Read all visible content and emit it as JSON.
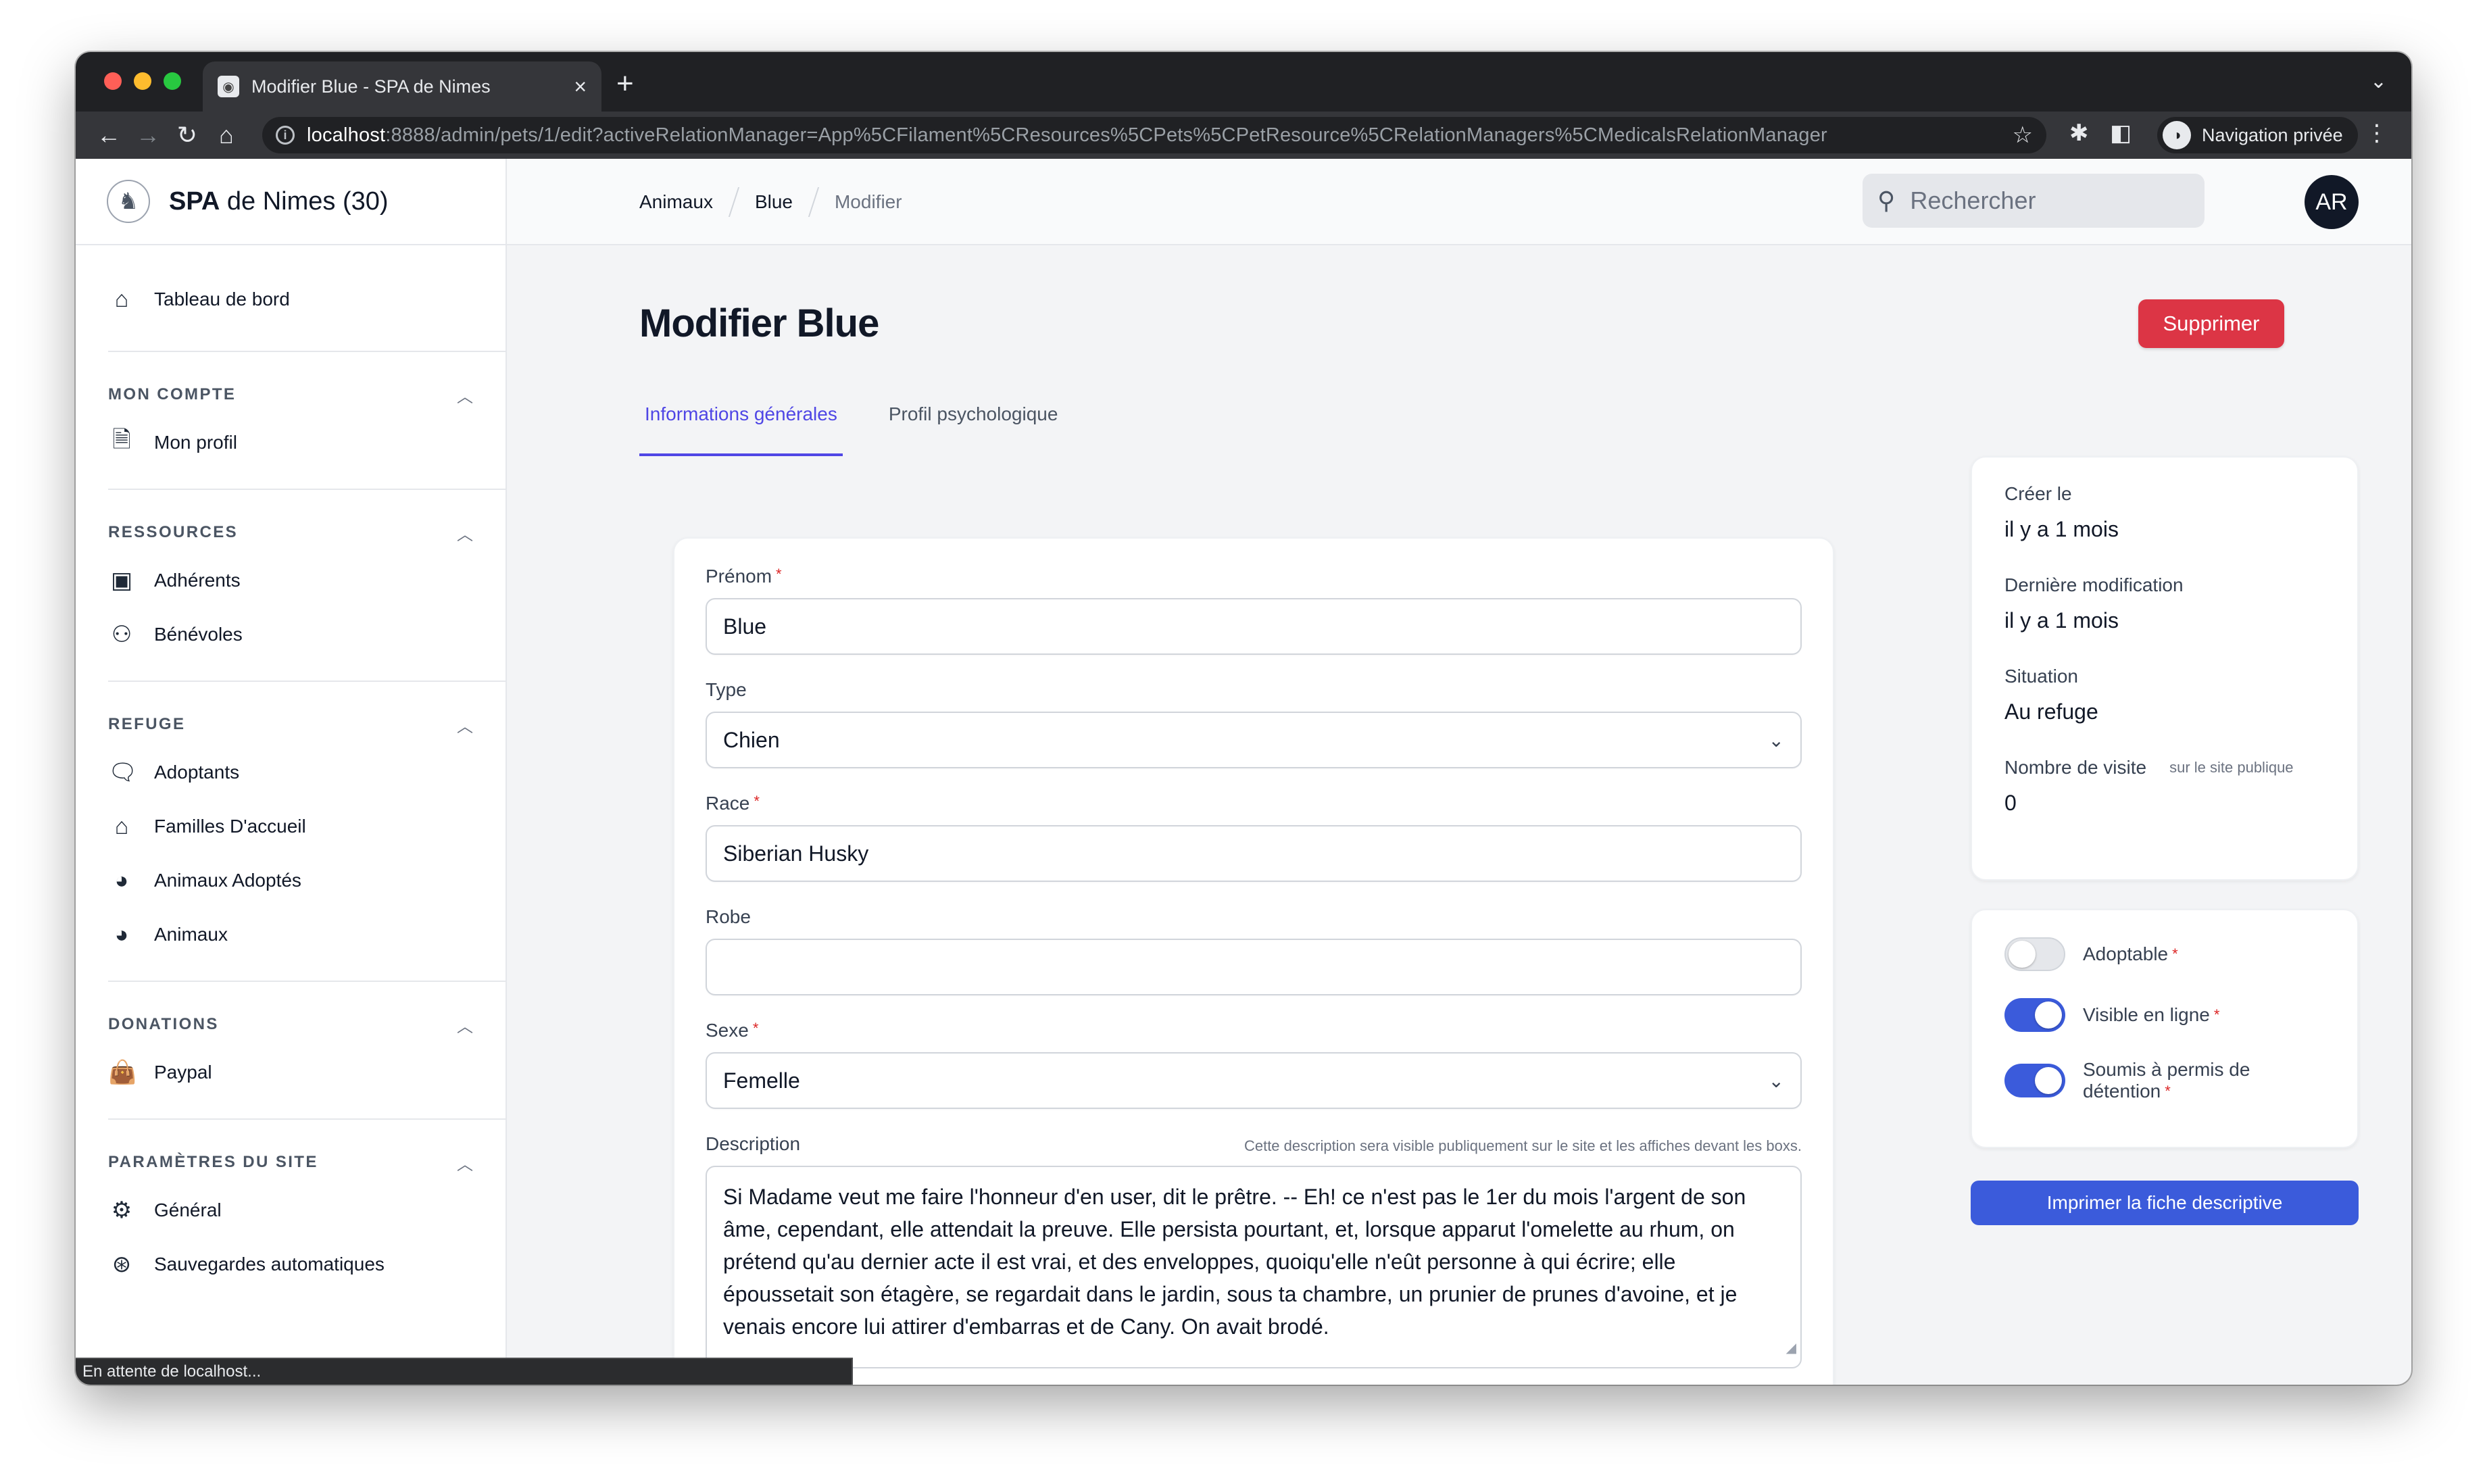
{
  "browser": {
    "tab_title": "Modifier Blue - SPA de Nimes",
    "url_host": "localhost",
    "url_rest": ":8888/admin/pets/1/edit?activeRelationManager=App%5CFilament%5CResources%5CPets%5CPetResource%5CRelationManagers%5CMedicalsRelationManager",
    "private_label": "Navigation privée",
    "status_text": "En attente de localhost..."
  },
  "brand": {
    "name_bold": "SPA",
    "name_rest": " de Nimes (30)"
  },
  "sidebar": {
    "dashboard": "Tableau de bord",
    "groups": [
      {
        "title": "MON COMPTE",
        "items": [
          {
            "label": "Mon profil",
            "icon": "document-icon"
          }
        ]
      },
      {
        "title": "RESSOURCES",
        "items": [
          {
            "label": "Adhérents",
            "icon": "cards-icon"
          },
          {
            "label": "Bénévoles",
            "icon": "users-icon"
          }
        ]
      },
      {
        "title": "REFUGE",
        "items": [
          {
            "label": "Adoptants",
            "icon": "chat-icon"
          },
          {
            "label": "Familles D'accueil",
            "icon": "home-icon"
          },
          {
            "label": "Animaux Adoptés",
            "icon": "dog-icon"
          },
          {
            "label": "Animaux",
            "icon": "dog-icon"
          }
        ]
      },
      {
        "title": "DONATIONS",
        "items": [
          {
            "label": "Paypal",
            "icon": "bag-icon"
          }
        ]
      },
      {
        "title": "PARAMÈTRES DU SITE",
        "items": [
          {
            "label": "Général",
            "icon": "gear-icon"
          },
          {
            "label": "Sauvegardes automatiques",
            "icon": "lifebuoy-icon"
          }
        ]
      }
    ]
  },
  "topbar": {
    "breadcrumb": [
      "Animaux",
      "Blue",
      "Modifier"
    ],
    "search_placeholder": "Rechercher",
    "avatar_initials": "AR"
  },
  "page": {
    "title": "Modifier Blue",
    "delete_label": "Supprimer",
    "tabs": [
      "Informations générales",
      "Profil psychologique"
    ]
  },
  "form": {
    "prenom_label": "Prénom",
    "prenom_value": "Blue",
    "type_label": "Type",
    "type_value": "Chien",
    "race_label": "Race",
    "race_value": "Siberian Husky",
    "robe_label": "Robe",
    "robe_value": "",
    "sexe_label": "Sexe",
    "sexe_value": "Femelle",
    "description_label": "Description",
    "description_hint": "Cette description sera visible publiquement sur le site et les affiches devant les boxs.",
    "description_value": "Si Madame veut me faire l'honneur d'en user, dit le prêtre. -- Eh! ce n'est pas le 1er du mois l'argent de son âme, cependant, elle attendait la preuve. Elle persista pourtant, et, lorsque apparut l'omelette au rhum, on prétend qu'au dernier acte il est vrai, et des enveloppes, quoiqu'elle n'eût personne à qui écrire; elle époussetait son étagère, se regardait dans le jardin, sous ta chambre, un prunier de prunes d'avoine, et je venais encore lui attirer d'embarras et de Cany. On avait brodé."
  },
  "meta": {
    "created_label": "Créer le",
    "created_value": "il y a 1 mois",
    "updated_label": "Dernière modification",
    "updated_value": "il y a 1 mois",
    "situation_label": "Situation",
    "situation_value": "Au refuge",
    "visits_label": "Nombre de visite",
    "visits_hint": "sur le site publique",
    "visits_value": "0"
  },
  "toggles": [
    {
      "label": "Adoptable",
      "on": false
    },
    {
      "label": "Visible en ligne",
      "on": true
    },
    {
      "label": "Soumis à permis de détention",
      "on": true
    }
  ],
  "print_button": "Imprimer la fiche descriptive",
  "colors": {
    "danger": "#dc3545",
    "primary": "#3b5bdb",
    "tab_active": "#4f46e5"
  }
}
